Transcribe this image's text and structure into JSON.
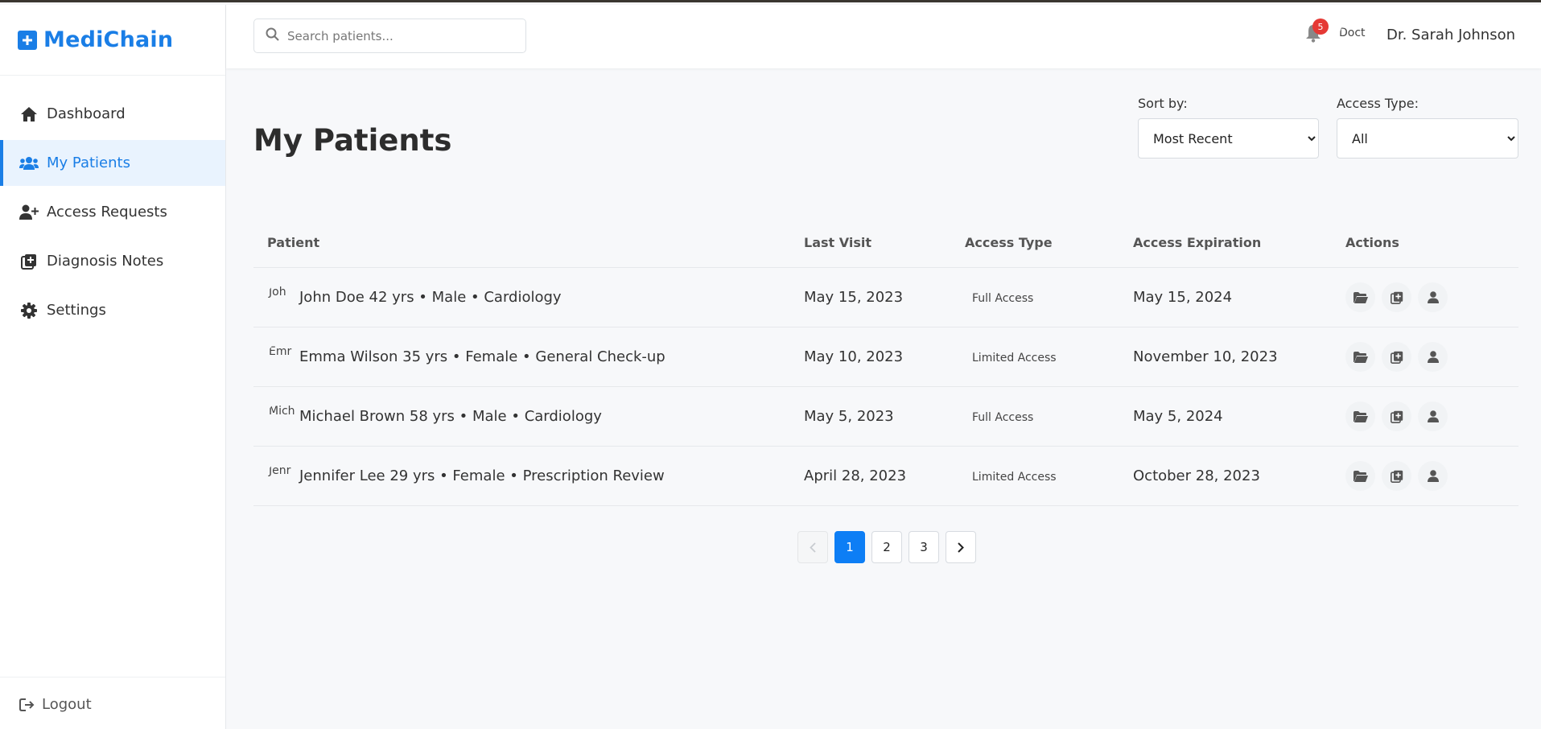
{
  "app": {
    "name": "MediChain"
  },
  "sidebar": {
    "items": [
      {
        "label": "Dashboard",
        "icon": "home-icon"
      },
      {
        "label": "My Patients",
        "icon": "users-icon",
        "active": true
      },
      {
        "label": "Access Requests",
        "icon": "user-plus-icon"
      },
      {
        "label": "Diagnosis Notes",
        "icon": "notes-icon"
      },
      {
        "label": "Settings",
        "icon": "gear-icon"
      }
    ],
    "logout": "Logout"
  },
  "header": {
    "search_placeholder": "Search patients...",
    "notification_count": "5",
    "avatar_alt": "Doct",
    "user_name": "Dr. Sarah Johnson"
  },
  "page": {
    "title": "My Patients",
    "sort": {
      "label": "Sort by:",
      "selected": "Most Recent"
    },
    "access_filter": {
      "label": "Access Type:",
      "selected": "All"
    }
  },
  "table": {
    "columns": [
      "Patient",
      "Last Visit",
      "Access Type",
      "Access Expiration",
      "Actions"
    ],
    "rows": [
      {
        "avatar_alt": "Joh",
        "patient": "John Doe 42 yrs • Male • Cardiology",
        "last_visit": "May 15, 2023",
        "access": "Full Access",
        "expiration": "May 15, 2024"
      },
      {
        "avatar_alt": "Emr",
        "patient": "Emma Wilson 35 yrs • Female • General Check-up",
        "last_visit": "May 10, 2023",
        "access": "Limited Access",
        "expiration": "November 10, 2023"
      },
      {
        "avatar_alt": "Mich",
        "patient": "Michael Brown 58 yrs • Male • Cardiology",
        "last_visit": "May 5, 2023",
        "access": "Full Access",
        "expiration": "May 5, 2024"
      },
      {
        "avatar_alt": "Jenr",
        "patient": "Jennifer Lee 29 yrs • Female • Prescription Review",
        "last_visit": "April 28, 2023",
        "access": "Limited Access",
        "expiration": "October 28, 2023"
      }
    ],
    "action_icons": [
      "folder-icon",
      "add-note-icon",
      "profile-icon"
    ]
  },
  "pagination": {
    "pages": [
      "1",
      "2",
      "3"
    ],
    "current": "1"
  },
  "colors": {
    "accent": "#1a7ee6",
    "badge": "#e53935",
    "background": "#f7f8fa"
  }
}
